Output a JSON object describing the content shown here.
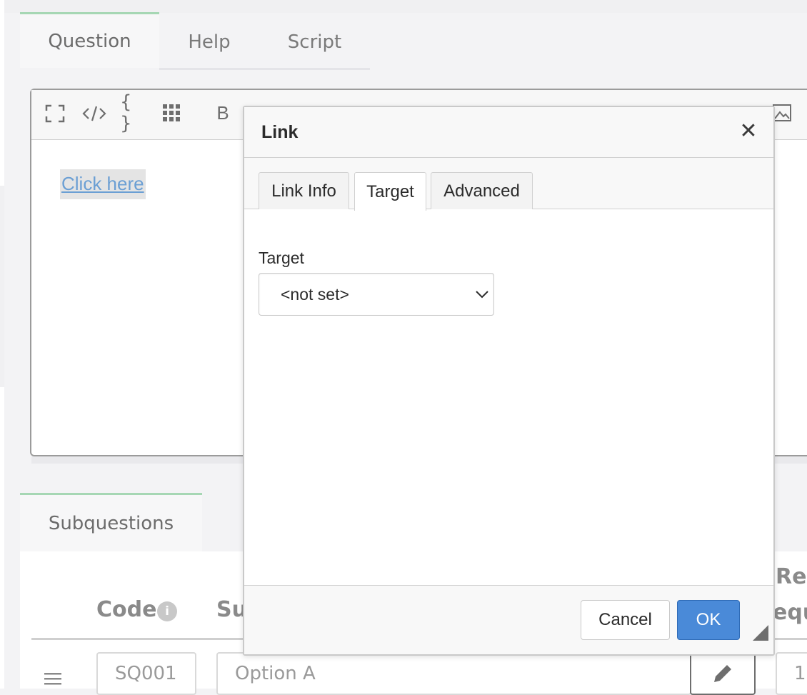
{
  "question_tabs": [
    {
      "label": "Question",
      "active": true
    },
    {
      "label": "Help",
      "active": false
    },
    {
      "label": "Script",
      "active": false
    }
  ],
  "editor": {
    "toolbar_icons": [
      "fullscreen-icon",
      "source-code-icon",
      "placeholder-braces-icon",
      "grid-icon",
      "bold-icon",
      "image-icon"
    ],
    "bold_label": "B",
    "link_text": "Click here"
  },
  "subquestions": {
    "tab_label": "Subquestions",
    "columns": {
      "code": "Code",
      "subquestion": "Su",
      "relevance_top": "Rel",
      "relevance_bottom": "equ"
    },
    "rows": [
      {
        "code": "SQ001",
        "text": "Option A",
        "relevance": "1"
      }
    ]
  },
  "dialog": {
    "title": "Link",
    "close_label": "✕",
    "tabs": [
      {
        "label": "Link Info",
        "active": false
      },
      {
        "label": "Target",
        "active": true
      },
      {
        "label": "Advanced",
        "active": false
      }
    ],
    "target_label": "Target",
    "target_value": "<not set>",
    "cancel_label": "Cancel",
    "ok_label": "OK"
  },
  "colors": {
    "accent_green": "#a6d7b4",
    "ok_button": "#4a8ad8",
    "link": "#6b9fd4"
  }
}
